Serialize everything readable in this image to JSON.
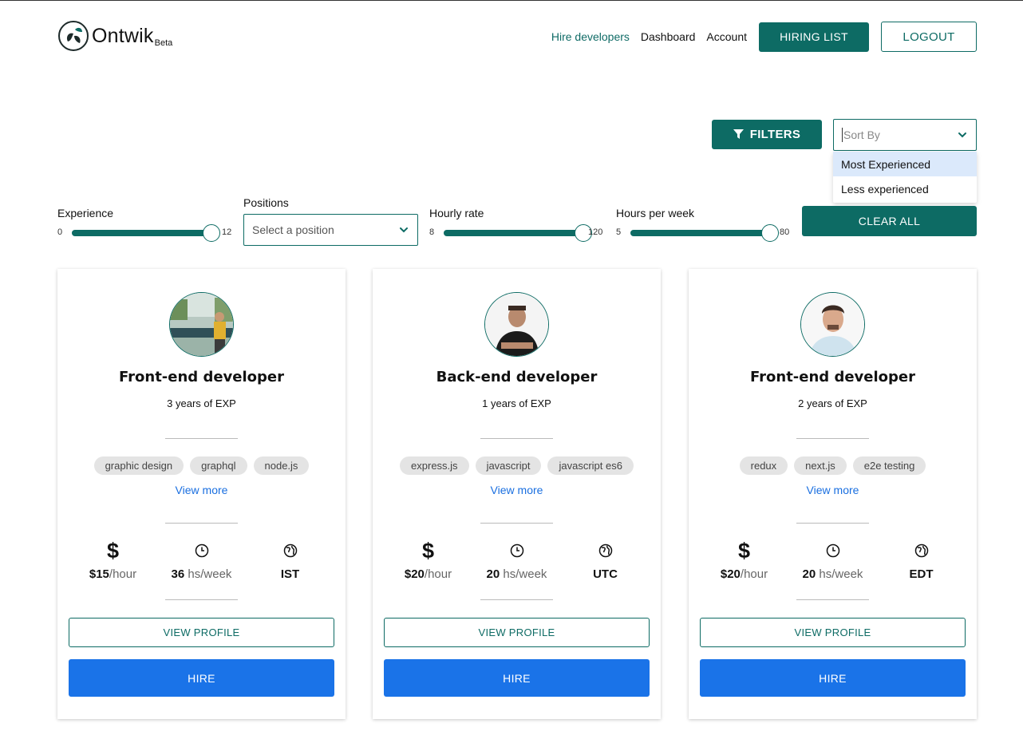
{
  "header": {
    "logo_text": "Ontwik",
    "logo_badge": "Beta",
    "nav": [
      "Hire developers",
      "Dashboard",
      "Account"
    ],
    "hiring_list_label": "HIRING LIST",
    "logout_label": "LOGOUT"
  },
  "toolbar": {
    "filters_label": "FILTERS",
    "sort_placeholder": "Sort By",
    "sort_options": [
      "Most Experienced",
      "Less experienced"
    ],
    "sort_highlighted": "Most Experienced"
  },
  "filters": {
    "experience": {
      "label": "Experience",
      "min": 0,
      "max": 12,
      "value": 12
    },
    "positions": {
      "label": "Positions",
      "placeholder": "Select a position"
    },
    "hourly_rate": {
      "label": "Hourly rate",
      "min": 8,
      "max": 120,
      "value": 120
    },
    "hours_per_week": {
      "label": "Hours per week",
      "min": 5,
      "max": 80,
      "value": 80
    },
    "clear_all_label": "CLEAR ALL"
  },
  "cards": [
    {
      "title": "Front-end developer",
      "experience": "3 years of EXP",
      "tags": [
        "graphic design",
        "graphql",
        "node.js"
      ],
      "view_more": "View more",
      "rate_currency": "$",
      "rate": "$15",
      "rate_unit": "/hour",
      "hours": "36",
      "hours_unit": " hs/week",
      "timezone": "IST",
      "view_profile_label": "VIEW PROFILE",
      "hire_label": "HIRE"
    },
    {
      "title": "Back-end developer",
      "experience": "1 years of EXP",
      "tags": [
        "express.js",
        "javascript",
        "javascript es6"
      ],
      "view_more": "View more",
      "rate_currency": "$",
      "rate": "$20",
      "rate_unit": "/hour",
      "hours": "20",
      "hours_unit": " hs/week",
      "timezone": "UTC",
      "view_profile_label": "VIEW PROFILE",
      "hire_label": "HIRE"
    },
    {
      "title": "Front-end developer",
      "experience": "2 years of EXP",
      "tags": [
        "redux",
        "next.js",
        "e2e testing"
      ],
      "view_more": "View more",
      "rate_currency": "$",
      "rate": "$20",
      "rate_unit": "/hour",
      "hours": "20",
      "hours_unit": " hs/week",
      "timezone": "EDT",
      "view_profile_label": "VIEW PROFILE",
      "hire_label": "HIRE"
    }
  ],
  "colors": {
    "brand": "#0d6b64",
    "hire": "#1a73e8",
    "link": "#1a6fe0",
    "tag_bg": "#e4e4e4"
  }
}
